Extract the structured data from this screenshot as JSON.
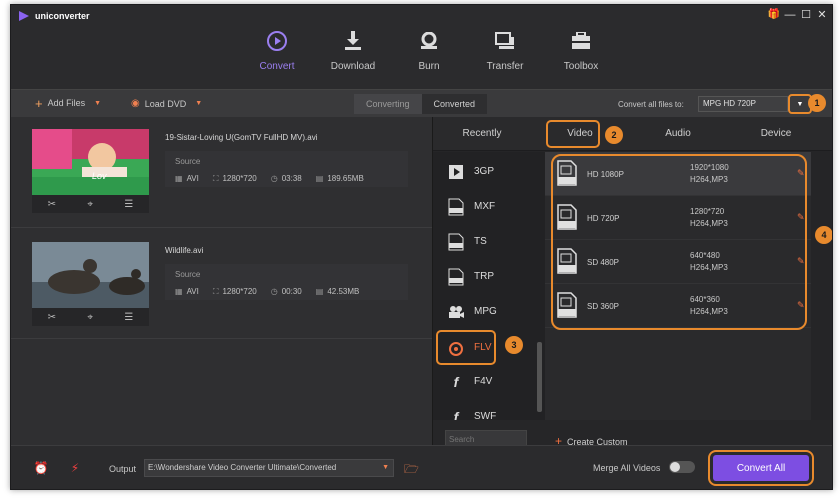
{
  "app": {
    "name": "uniconverter",
    "accent": "#7d4ee2",
    "highlight": "#e88a2d"
  },
  "window_controls": [
    "gift-icon",
    "minimize-icon",
    "maximize-icon",
    "close-icon"
  ],
  "nav": [
    {
      "label": "Convert",
      "icon": "convert-icon",
      "active": true
    },
    {
      "label": "Download",
      "icon": "download-icon",
      "active": false
    },
    {
      "label": "Burn",
      "icon": "burn-icon",
      "active": false
    },
    {
      "label": "Transfer",
      "icon": "transfer-icon",
      "active": false
    },
    {
      "label": "Toolbox",
      "icon": "toolbox-icon",
      "active": false
    }
  ],
  "toolbar": {
    "add_files": "Add Files",
    "load_dvd": "Load DVD",
    "tab_converting": "Converting",
    "tab_converted": "Converted",
    "convert_all_label": "Convert all files to:",
    "convert_all_value": "MPG HD 720P"
  },
  "callouts": [
    "1",
    "2",
    "3",
    "4"
  ],
  "files": [
    {
      "name": "19-Sistar-Loving U(GomTV FullHD MV).avi",
      "source_label": "Source",
      "format": "AVI",
      "resolution": "1280*720",
      "duration": "03:38",
      "size": "189.65MB"
    },
    {
      "name": "Wildlife.avi",
      "source_label": "Source",
      "format": "AVI",
      "resolution": "1280*720",
      "duration": "00:30",
      "size": "42.53MB"
    }
  ],
  "panel": {
    "tabs": [
      "Recently",
      "Video",
      "Audio",
      "Device"
    ],
    "categories": [
      "3GP",
      "MXF",
      "TS",
      "TRP",
      "MPG",
      "FLV",
      "F4V",
      "SWF"
    ],
    "selected_category": "FLV",
    "presets": [
      {
        "name": "HD 1080P",
        "badge": "1080P",
        "resolution": "1920*1080",
        "codec": "H264,MP3"
      },
      {
        "name": "HD 720P",
        "badge": "720P",
        "resolution": "1280*720",
        "codec": "H264,MP3"
      },
      {
        "name": "SD 480P",
        "badge": "480P",
        "resolution": "640*480",
        "codec": "H264,MP3"
      },
      {
        "name": "SD 360P",
        "badge": "360P",
        "resolution": "640*360",
        "codec": "H264,MP3"
      }
    ],
    "search_placeholder": "Search",
    "create_custom": "Create Custom"
  },
  "bottom": {
    "output_label": "Output",
    "output_path": "E:\\Wondershare Video Converter Ultimate\\Converted",
    "merge_label": "Merge All Videos",
    "convert_all_button": "Convert All"
  }
}
